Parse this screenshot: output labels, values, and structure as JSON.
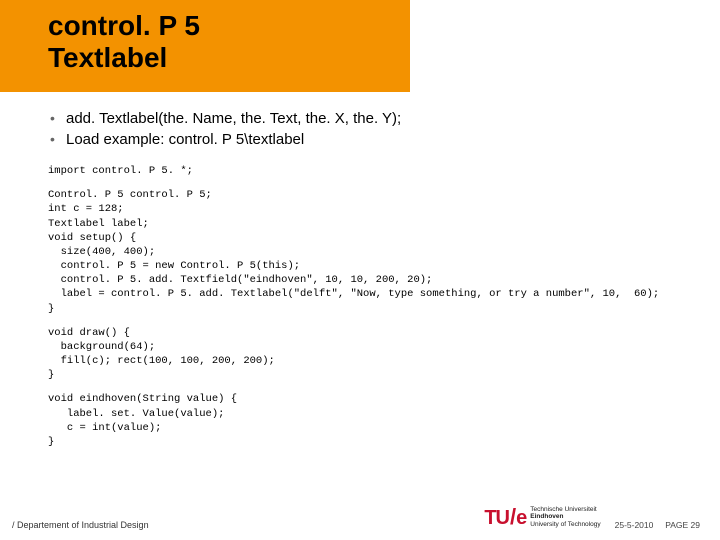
{
  "title": {
    "line1": "control. P 5",
    "line2": "Textlabel"
  },
  "bullets": [
    "add. Textlabel(the. Name, the. Text, the. X, the. Y);",
    "Load example: control. P 5\\textlabel"
  ],
  "code": {
    "block1": "import control. P 5. *;",
    "block2": "Control. P 5 control. P 5;\nint c = 128;\nTextlabel label;\nvoid setup() {\n  size(400, 400);\n  control. P 5 = new Control. P 5(this);\n  control. P 5. add. Textfield(\"eindhoven\", 10, 10, 200, 20);\n  label = control. P 5. add. Textlabel(\"delft\", \"Now, type something, or try a number\", 10,  60);\n}",
    "block3": "void draw() {\n  background(64);\n  fill(c); rect(100, 100, 200, 200);\n}",
    "block4": "void eindhoven(String value) {\n   label. set. Value(value);\n   c = int(value);\n}"
  },
  "footer": {
    "department": "/ Departement of Industrial Design",
    "logo_tu": "TU",
    "logo_e": "e",
    "logo_text_1": "Technische Universiteit",
    "logo_text_2": "Eindhoven",
    "logo_text_3": "University of Technology",
    "date": "25-5-2010",
    "page": "PAGE 29"
  }
}
